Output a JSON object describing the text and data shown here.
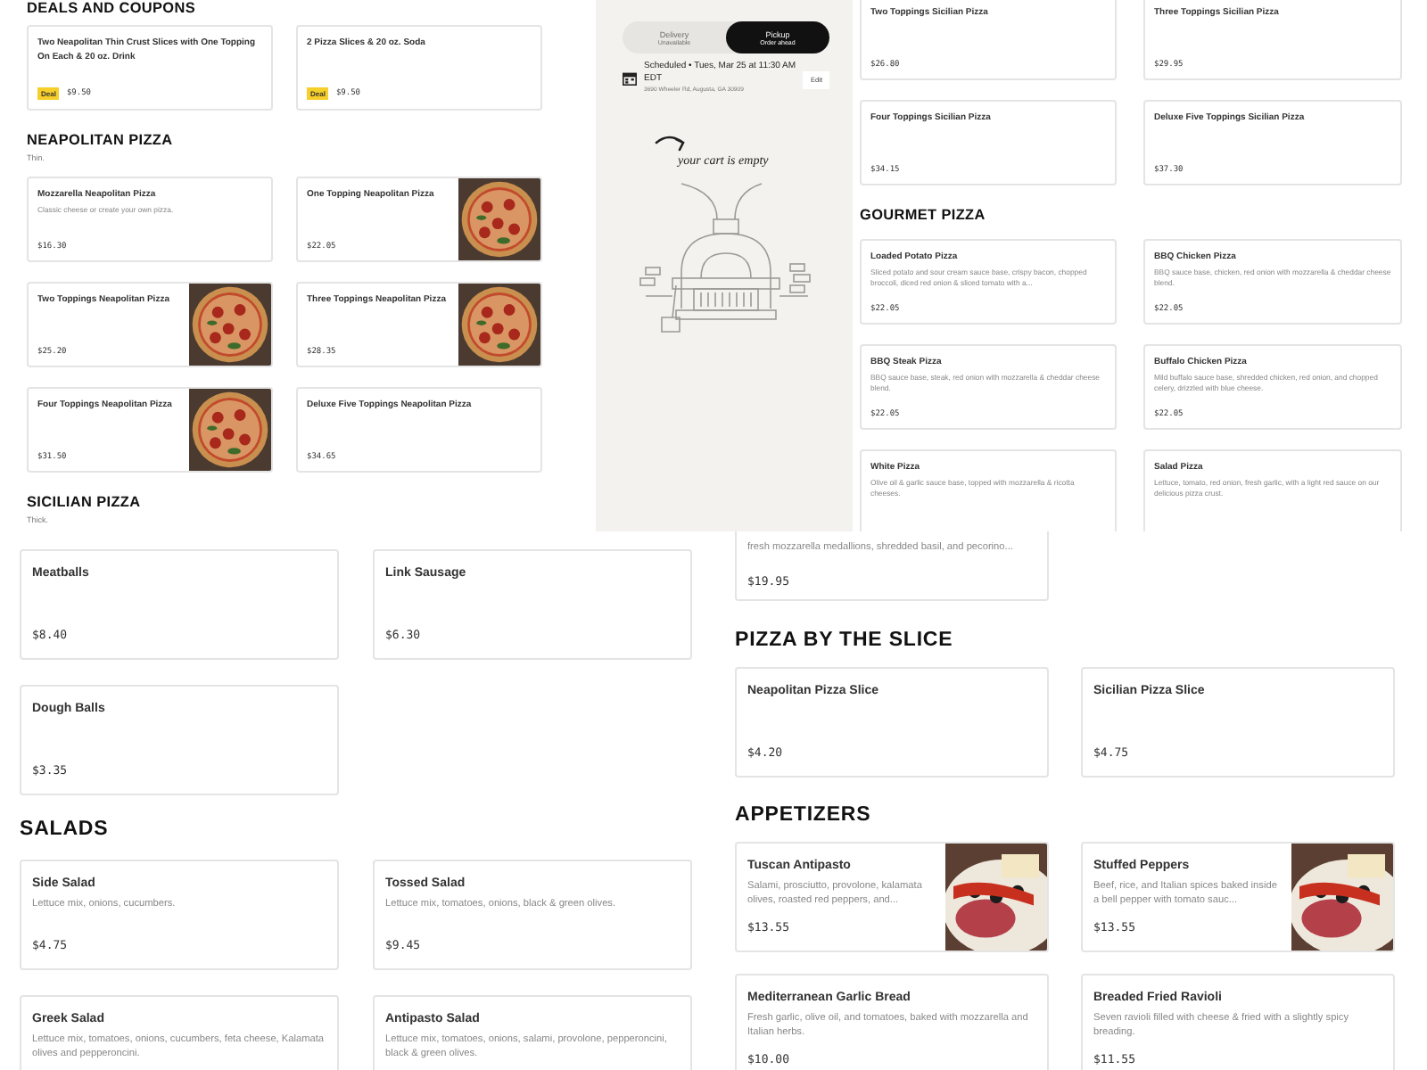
{
  "top_view": {
    "deals": {
      "title": "DEALS AND COUPONS",
      "items": [
        {
          "name": "Two Neapolitan Thin Crust Slices with One Topping On Each & 20 oz. Drink",
          "badge": "Deal",
          "price": "$9.50"
        },
        {
          "name": "2 Pizza Slices & 20 oz. Soda",
          "badge": "Deal",
          "price": "$9.50"
        }
      ]
    },
    "neapolitan": {
      "title": "NEAPOLITAN PIZZA",
      "subtitle": "Thin.",
      "items": [
        {
          "name": "Mozzarella Neapolitan Pizza",
          "description": "Classic cheese or create your own pizza.",
          "price": "$16.30"
        },
        {
          "kind": "picture",
          "name": "One Topping Neapolitan Pizza",
          "price": "$22.05"
        },
        {
          "kind": "picture",
          "name": "Two Toppings Neapolitan Pizza",
          "price": "$25.20"
        },
        {
          "kind": "picture",
          "name": "Three Toppings Neapolitan Pizza",
          "price": "$28.35"
        },
        {
          "kind": "picture",
          "name": "Four Toppings Neapolitan Pizza",
          "price": "$31.50"
        },
        {
          "name": "Deluxe Five Toppings Neapolitan Pizza",
          "price": "$34.65"
        }
      ]
    },
    "sicilian_heading": {
      "title": "SICILIAN PIZZA",
      "subtitle": "Thick."
    },
    "cart": {
      "fulfillment_options": [
        {
          "label": "Delivery",
          "sublabel": "Unavailable",
          "selected": false
        },
        {
          "label": "Pickup",
          "sublabel": "Order ahead",
          "selected": true
        }
      ],
      "schedule": "Scheduled • Tues, Mar 25 at 11:30 AM EDT",
      "address": "3690 Wheeler Rd, Augusta, GA 30909",
      "edit_button": "Edit",
      "empty_message": "your cart is empty"
    },
    "sicilian_items": [
      {
        "name": "Two Toppings Sicilian Pizza",
        "price": "$26.80"
      },
      {
        "name": "Three Toppings Sicilian Pizza",
        "price": "$29.95"
      },
      {
        "name": "Four Toppings Sicilian Pizza",
        "price": "$34.15"
      },
      {
        "name": "Deluxe Five Toppings Sicilian Pizza",
        "price": "$37.30"
      }
    ],
    "gourmet": {
      "title": "GOURMET PIZZA",
      "items": [
        {
          "name": "Loaded Potato Pizza",
          "description": "Sliced potato and sour cream sauce base, crispy bacon, chopped broccoli, diced red onion & sliced tomato with a...",
          "price": "$22.05"
        },
        {
          "name": "BBQ Chicken Pizza",
          "description": "BBQ sauce base, chicken, red onion with mozzarella & cheddar cheese blend.",
          "price": "$22.05"
        },
        {
          "name": "BBQ Steak Pizza",
          "description": "BBQ sauce base, steak, red onion with mozzarella & cheddar cheese blend.",
          "price": "$22.05"
        },
        {
          "name": "Buffalo Chicken Pizza",
          "description": "Mild buffalo sauce base, shredded chicken, red onion, and chopped celery, drizzled with blue cheese.",
          "price": "$22.05"
        },
        {
          "name": "White Pizza",
          "description": "Olive oil & garlic sauce base, topped with mozzarella & ricotta cheeses."
        },
        {
          "name": "Salad Pizza",
          "description": "Lettuce, tomato, red onion, fresh garlic, with a light red sauce on our delicious pizza crust."
        }
      ]
    }
  },
  "bottom_view": {
    "sides": [
      {
        "name": "Meatballs",
        "price": "$8.40"
      },
      {
        "name": "Link Sausage",
        "price": "$6.30"
      },
      {
        "name": "Dough Balls",
        "price": "$3.35"
      }
    ],
    "salads": {
      "title": "SALADS",
      "items": [
        {
          "name": "Side Salad",
          "description": "Lettuce mix, onions, cucumbers.",
          "price": "$4.75"
        },
        {
          "name": "Tossed Salad",
          "description": "Lettuce mix, tomatoes, onions, black & green olives.",
          "price": "$9.45"
        },
        {
          "name": "Greek Salad",
          "description": "Lettuce mix, tomatoes, onions, cucumbers, feta cheese, Kalamata olives and pepperoncini."
        },
        {
          "name": "Antipasto Salad",
          "description": "Lettuce mix, tomatoes, onions, salami, provolone, pepperoncini, black & green olives."
        }
      ]
    },
    "partial_item": {
      "description": "fresh mozzarella medallions, shredded basil, and pecorino...",
      "price": "$19.95"
    },
    "slices": {
      "title": "PIZZA BY THE SLICE",
      "items": [
        {
          "name": "Neapolitan Pizza Slice",
          "price": "$4.20"
        },
        {
          "name": "Sicilian Pizza Slice",
          "price": "$4.75"
        }
      ]
    },
    "appetizers": {
      "title": "APPETIZERS",
      "items": [
        {
          "kind": "picture",
          "name": "Tuscan Antipasto",
          "description": "Salami, prosciutto, provolone, kalamata olives, roasted red peppers, and...",
          "price": "$13.55"
        },
        {
          "kind": "picture",
          "name": "Stuffed Peppers",
          "description": "Beef, rice, and Italian spices baked inside a bell pepper with tomato sauc...",
          "price": "$13.55"
        },
        {
          "name": "Mediterranean Garlic Bread",
          "description": "Fresh garlic, olive oil, and tomatoes, baked with mozzarella and Italian herbs.",
          "price": "$10.00"
        },
        {
          "name": "Breaded Fried Ravioli",
          "description": "Seven ravioli filled with cheese & fried with a slightly spicy breading.",
          "price": "$11.55"
        }
      ]
    }
  }
}
